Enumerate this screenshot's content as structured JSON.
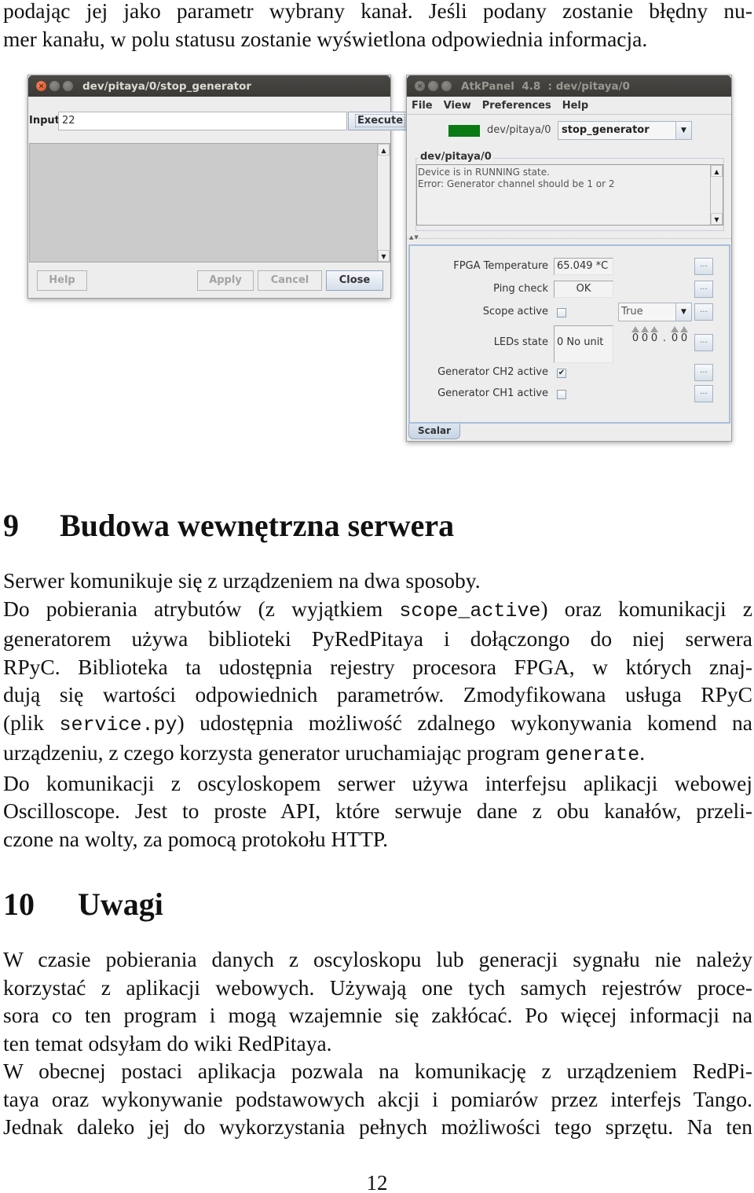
{
  "document": {
    "intro_lines": [
      "podając jej jako parametr wybrany kanał. Jeśli podany zostanie błędny nu-",
      "mer kanału, w polu statusu zostanie wyświetlona odpowiednia informacja."
    ],
    "section9": {
      "number": "9",
      "title": "Budowa wewnętrzna serwera",
      "lines": [
        {
          "parts": [
            "Serwer komunikuje się z urządzeniem na dwa sposoby."
          ],
          "last": true
        },
        {
          "parts": [
            "Do pobierania atrybutów (z wyjątkiem ",
            "scope_active",
            ") oraz komunikacji z"
          ]
        },
        {
          "parts": [
            "generatorem używa biblioteki PyRedPitaya i dołączongo do niej serwera"
          ]
        },
        {
          "parts": [
            "RPyC. Biblioteka ta udostępnia rejestry procesora FPGA, w których znaj-"
          ]
        },
        {
          "parts": [
            "dują się wartości odpowiednich parametrów. Zmodyfikowana usługa RPyC"
          ]
        },
        {
          "parts": [
            "(plik ",
            "service.py",
            ") udostępnia możliwość zdalnego wykonywania komend na"
          ]
        },
        {
          "parts": [
            "urządzeniu, z czego korzysta generator uruchamiając program ",
            "generate",
            "."
          ],
          "last": true
        },
        {
          "parts": [
            "Do komunikacji z oscyloskopem serwer używa interfejsu aplikacji webowej"
          ]
        },
        {
          "parts": [
            "Oscilloscope. Jest to proste API, które serwuje dane z obu kanałów, przeli-"
          ]
        },
        {
          "parts": [
            "czone na wolty, za pomocą protokołu HTTP."
          ],
          "last": true
        }
      ]
    },
    "section10": {
      "number": "10",
      "title": "Uwagi",
      "lines": [
        {
          "parts": [
            "W czasie pobierania danych z oscyloskopu lub generacji sygnału nie należy"
          ]
        },
        {
          "parts": [
            "korzystać z aplikacji webowych. Używają one tych samych rejestrów proce-"
          ]
        },
        {
          "parts": [
            "sora co ten program i mogą wzajemnie się zakłócać. Po więcej informacji na"
          ]
        },
        {
          "parts": [
            "ten temat odsyłam do wiki RedPitaya."
          ],
          "last": true
        },
        {
          "parts": [
            "W obecnej postaci aplikacja pozwala na komunikację z urządzeniem RedPi-"
          ]
        },
        {
          "parts": [
            "taya oraz wykonywanie podstawowych akcji i pomiarów przez interfejs Tango."
          ]
        },
        {
          "parts": [
            "Jednak daleko jej do wykorzystania pełnych możliwości tego sprzętu. Na ten"
          ]
        }
      ]
    },
    "page_number": "12"
  },
  "command_window": {
    "title": "dev/pitaya/0/stop_generator",
    "input_label": "Input",
    "input_value": "22",
    "execute_label": "Execute",
    "buttons": {
      "help": "Help",
      "apply": "Apply",
      "cancel": "Cancel",
      "close": "Close"
    }
  },
  "atk_panel": {
    "title": "AtkPanel  4.8  : dev/pitaya/0",
    "menu": [
      "File",
      "View",
      "Preferences",
      "Help"
    ],
    "device_name": "dev/pitaya/0",
    "state_color": "#0a7a12",
    "selected_command": "stop_generator",
    "status_group_label": "dev/pitaya/0",
    "status_lines": [
      "Device is in RUNNING state.",
      "Error: Generator channel should be 1 or 2"
    ],
    "attributes": {
      "fpga_temperature": {
        "label": "FPGA Temperature",
        "value": "65.049 *C"
      },
      "ping_check": {
        "label": "Ping check",
        "value": "OK"
      },
      "scope_active": {
        "label": "Scope active",
        "checked": false,
        "setter_value": "True"
      },
      "leds_state": {
        "label": "LEDs state",
        "value": "0 No unit",
        "spinner_digits": [
          "0",
          "0",
          "0",
          ".",
          "0",
          "0"
        ]
      },
      "generator_ch2_active": {
        "label": "Generator CH2 active",
        "checked": true
      },
      "generator_ch1_active": {
        "label": "Generator CH1 active",
        "checked": false
      }
    },
    "more_button_label": "...",
    "tab_label": "Scalar"
  }
}
